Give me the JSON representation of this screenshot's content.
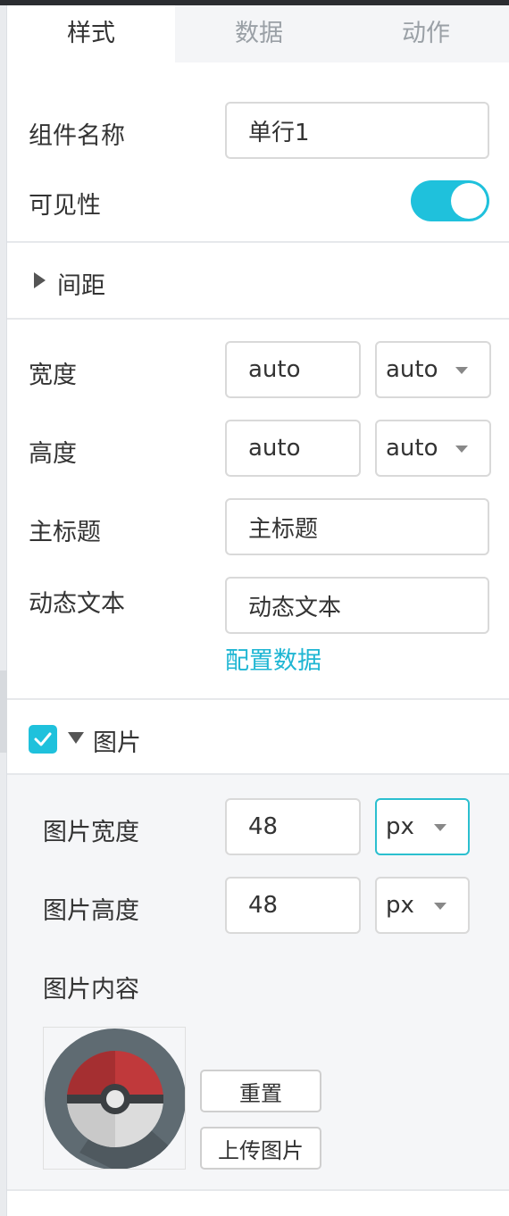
{
  "tabs": [
    {
      "label": "样式",
      "active": true
    },
    {
      "label": "数据",
      "active": false
    },
    {
      "label": "动作",
      "active": false
    }
  ],
  "component_name": {
    "label": "组件名称",
    "value": "单行1"
  },
  "visibility": {
    "label": "可见性",
    "on": true
  },
  "spacing_section": {
    "label": "间距",
    "expanded": false
  },
  "width": {
    "label": "宽度",
    "value": "auto",
    "unit": "auto"
  },
  "height": {
    "label": "高度",
    "value": "auto",
    "unit": "auto"
  },
  "main_title": {
    "label": "主标题",
    "value": "主标题"
  },
  "dynamic_text": {
    "label": "动态文本",
    "value": "动态文本",
    "link": "配置数据"
  },
  "image_section": {
    "label": "图片",
    "checked": true,
    "expanded": true,
    "image_width": {
      "label": "图片宽度",
      "value": "48",
      "unit": "px"
    },
    "image_height": {
      "label": "图片高度",
      "value": "48",
      "unit": "px"
    },
    "content_label": "图片内容",
    "thumbnail_icon": "pokeball-icon",
    "reset_button": "重置",
    "upload_button": "上传图片"
  },
  "colors": {
    "accent": "#1fc1dc",
    "link": "#1fb6d3"
  }
}
